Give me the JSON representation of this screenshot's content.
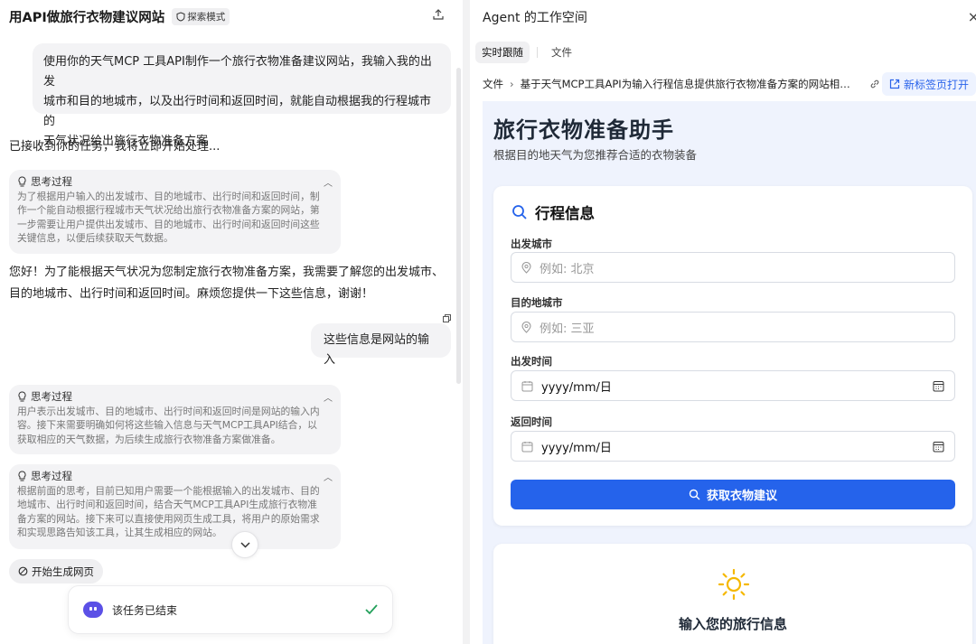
{
  "left": {
    "title": "用API做旅行衣物建议网站",
    "badge": "探索模式",
    "user_msg_1": [
      "使用你的天气MCP 工具API制作一个旅行衣物准备建议网站，我输入我的出发",
      "城市和目的地城市，以及出行时间和返回时间，就能自动根据我的行程城市的",
      "天气状况给出旅行衣物准备方案"
    ],
    "ack": "已接收到你的任务，我将立即开始处理...",
    "think_label": "思考过程",
    "think_1": [
      "为了根据用户输入的出发城市、目的地城市、出行时间和返回时间，制",
      "作一个能自动根据行程城市天气状况给出旅行衣物准备方案的网站，第",
      "一步需要让用户提供出发城市、目的地城市、出行时间和返回时间这些",
      "关键信息，以便后续获取天气数据。"
    ],
    "reply_1": [
      "您好！为了能根据天气状况为您制定旅行衣物准备方案，我需要了解您的出发城市、",
      "目的地城市、出行时间和返回时间。麻烦您提供一下这些信息，谢谢！"
    ],
    "user_msg_2": "这些信息是网站的输入",
    "think_2": [
      "用户表示出发城市、目的地城市、出行时间和返回时间是网站的输入内",
      "容。接下来需要明确如何将这些输入信息与天气MCP工具API结合，以",
      "获取相应的天气数据，为后续生成旅行衣物准备方案做准备。"
    ],
    "think_3": [
      "根据前面的思考，目前已知用户需要一个能根据输入的出发城市、目的",
      "地城市、出行时间和返回时间，结合天气MCP工具API生成旅行衣物准",
      "备方案的网站。接下来可以直接使用网页生成工具，将用户的原始需求",
      "和实现思路告知该工具，让其生成相应的网站。"
    ],
    "gen_chip": "开始生成网页",
    "done_text": "该任务已结束"
  },
  "right": {
    "title": "Agent 的工作空间",
    "tabs": [
      "实时跟随",
      "文件"
    ],
    "crumb_root": "文件",
    "crumb_path": "基于天气MCP工具API为输入行程信息提供旅行衣物准备方案的网站相关...",
    "new_tab": "新标签页打开",
    "preview": {
      "title": "旅行衣物准备助手",
      "subtitle": "根据目的地天气为您推荐合适的衣物装备",
      "card_title": "行程信息",
      "fields": [
        {
          "label": "出发城市",
          "placeholder": "例如: 北京"
        },
        {
          "label": "目的地城市",
          "placeholder": "例如: 三亚"
        },
        {
          "label": "出发时间",
          "value": "yyyy/mm/日"
        },
        {
          "label": "返回时间",
          "value": "yyyy/mm/日"
        }
      ],
      "button": "获取衣物建议",
      "card2_title": "输入您的旅行信息"
    }
  },
  "colors": {
    "accent": "#2563eb",
    "sun": "#f5b800",
    "avatar": "#5b50e6",
    "check": "#22a05a"
  }
}
